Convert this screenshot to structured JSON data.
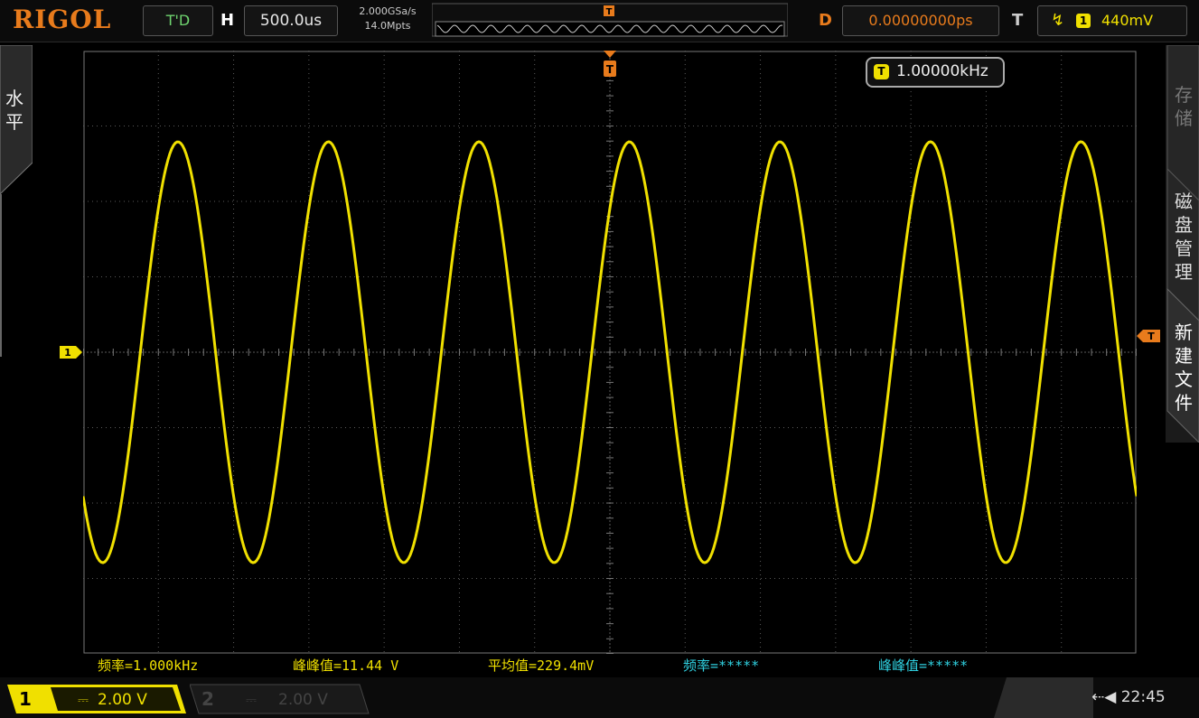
{
  "header": {
    "brand": "RIGOL",
    "run_state": "T'D",
    "horizontal_label": "H",
    "timebase": "500.0us",
    "sample_rate": "2.000GSa/s",
    "memory_depth": "14.0Mpts",
    "delay_label": "D",
    "delay_value": "0.00000000ps",
    "trigger_label": "T",
    "trigger_channel": "1",
    "trigger_level": "440mV",
    "trigger_marker": "T"
  },
  "left_tab": {
    "label_line1": "水",
    "label_line2": "平"
  },
  "right_menu": {
    "item1": [
      "存",
      "储"
    ],
    "item2": [
      "磁",
      "盘",
      "管",
      "理"
    ],
    "item3": [
      "新",
      "建",
      "文",
      "件"
    ]
  },
  "display": {
    "frequency_badge_icon": "T",
    "frequency_badge": "1.00000kHz",
    "ch1_marker": "1",
    "trigger_time_marker": "T",
    "trigger_level_marker": "T",
    "waveform": {
      "channel": 1,
      "frequency_hz": 1000,
      "periods_on_screen": 7,
      "color": "#f0e000"
    }
  },
  "measurements": [
    {
      "text": "频率=1.000kHz",
      "color": "#f0e000"
    },
    {
      "text": "峰峰值=11.44 V",
      "color": "#f0e000"
    },
    {
      "text": "平均值=229.4mV",
      "color": "#f0e000"
    },
    {
      "text": "频率=*****",
      "color": "#2fd0e0"
    },
    {
      "text": "峰峰值=*****",
      "color": "#2fd0e0"
    }
  ],
  "footer": {
    "ch1": {
      "number": "1",
      "coupling": "⎓",
      "scale": "2.00 V"
    },
    "ch2": {
      "number": "2",
      "coupling": "⎓",
      "scale": "2.00 V"
    },
    "clock": "22:45"
  },
  "colors": {
    "accent": "#e87b1c",
    "ch1": "#f0e000",
    "ch2": "#2fd0e0",
    "grid": "#5a5a5a"
  }
}
